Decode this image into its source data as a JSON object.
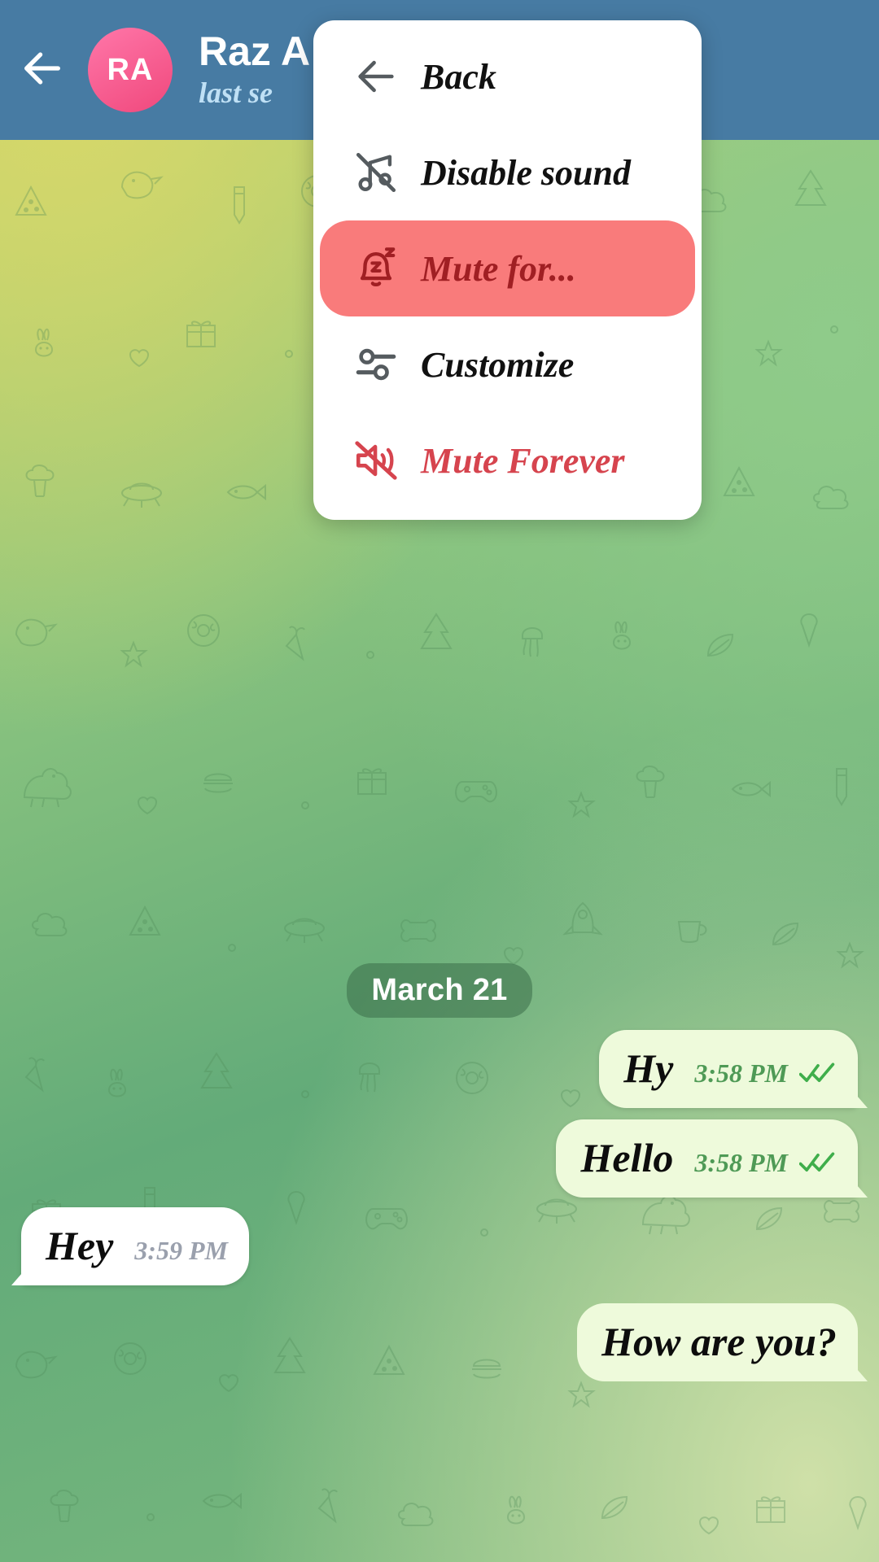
{
  "header": {
    "back_icon": "arrow-left-icon",
    "avatar_initials": "RA",
    "title": "Raz A",
    "status": "last se",
    "bg_color": "#477ba3",
    "avatar_color": "#f0487c"
  },
  "menu": {
    "highlight_color": "#f97b7b",
    "danger_color": "#d6444e",
    "items": [
      {
        "label": "Back",
        "icon": "arrow-left-icon",
        "state": "normal",
        "interactable": true
      },
      {
        "label": "Disable sound",
        "icon": "music-off-icon",
        "state": "normal",
        "interactable": true
      },
      {
        "label": "Mute for...",
        "icon": "bell-snooze-icon",
        "state": "highlight",
        "interactable": true
      },
      {
        "label": "Customize",
        "icon": "sliders-icon",
        "state": "normal",
        "interactable": true
      },
      {
        "label": "Mute Forever",
        "icon": "speaker-mute-icon",
        "state": "danger",
        "interactable": true
      }
    ]
  },
  "chat": {
    "date_divider": "March 21",
    "messages": [
      {
        "text": "Hy",
        "time": "3:58 PM",
        "direction": "out",
        "status": "read"
      },
      {
        "text": "Hello",
        "time": "3:58 PM",
        "direction": "out",
        "status": "read"
      },
      {
        "text": "Hey",
        "time": "3:59 PM",
        "direction": "in",
        "status": "none"
      },
      {
        "text": "How are you?",
        "time": "",
        "direction": "out",
        "status": "none"
      }
    ]
  }
}
